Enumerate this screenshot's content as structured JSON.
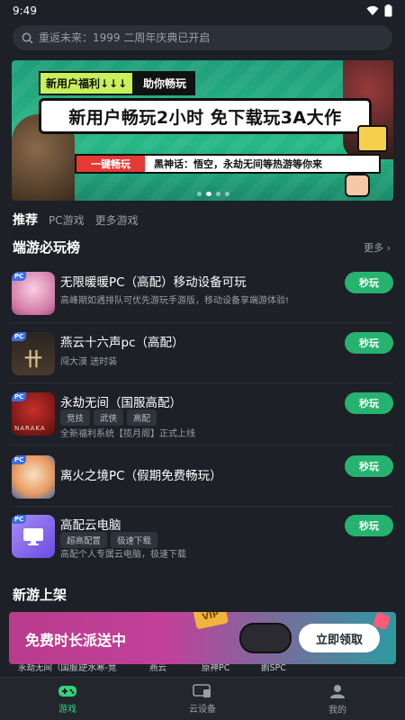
{
  "status_bar": {
    "time": "9:49"
  },
  "search": {
    "placeholder": "重返未来：1999 二周年庆典已开启"
  },
  "banner": {
    "tag_new_user": "新用户福利↓↓↓",
    "tag_help": "助你畅玩",
    "headline": "新用户畅玩2小时 免下载玩3A大作",
    "pill": "一键畅玩",
    "subtitle": "黑神话：悟空，永劫无间等热游等你来",
    "dots_total": 4,
    "dots_active_index": 1
  },
  "tabs": [
    "推荐",
    "PC游戏",
    "更多游戏"
  ],
  "section_top": {
    "title": "端游必玩榜",
    "more": "更多"
  },
  "games": [
    {
      "title": "无限暖暖PC（高配）移动设备可玩",
      "tags": [],
      "desc": "高峰期如遇排队可优先游玩手游版，移动设备享端游体验!",
      "button": "秒玩",
      "badge": "PC",
      "icon": "nikki-icon",
      "color": "#e8a0c8"
    },
    {
      "title": "燕云十六声pc（高配）",
      "tags": [],
      "desc": "闯大漠 送时装",
      "button": "秒玩",
      "badge": "PC",
      "icon": "yanyun-icon",
      "color": "#3a3028"
    },
    {
      "title": "永劫无间（国服高配）",
      "tags": [
        "竞技",
        "武侠",
        "高配"
      ],
      "desc": "全新福利系统【揽月阁】正式上线",
      "button": "秒玩",
      "badge": "PC",
      "icon": "naraka-icon",
      "color": "#8a1c1c",
      "icon_text": "NARAKA"
    },
    {
      "title": "离火之境PC（假期免费畅玩）",
      "tags": [],
      "desc": "",
      "button": "秒玩",
      "badge": "PC",
      "icon": "lihuo-icon",
      "color": "#e8b870"
    },
    {
      "title": "高配云电脑",
      "tags": [
        "超高配置",
        "极速下载"
      ],
      "desc": "高配个人专属云电脑，极速下载",
      "button": "秒玩",
      "badge": "PC",
      "icon": "cloud-pc-icon",
      "color": "#8a6cf0"
    }
  ],
  "section_new": {
    "title": "新游上架"
  },
  "promo": {
    "text": "免费时长派送中",
    "vip": "VIP",
    "button": "立即领取"
  },
  "peek_labels": [
    "永劫无间（国服）",
    "逆水寒-竞",
    "燕云",
    "原神PC",
    "鹅SPC"
  ],
  "bottom_nav": [
    {
      "label": "游戏",
      "icon": "gamepad-icon",
      "active": true
    },
    {
      "label": "云设备",
      "icon": "cloud-device-icon",
      "active": false
    },
    {
      "label": "我的",
      "icon": "profile-icon",
      "active": false
    }
  ],
  "colors": {
    "accent": "#26b36f",
    "active_nav": "#32d27a",
    "background": "#1d2026"
  }
}
